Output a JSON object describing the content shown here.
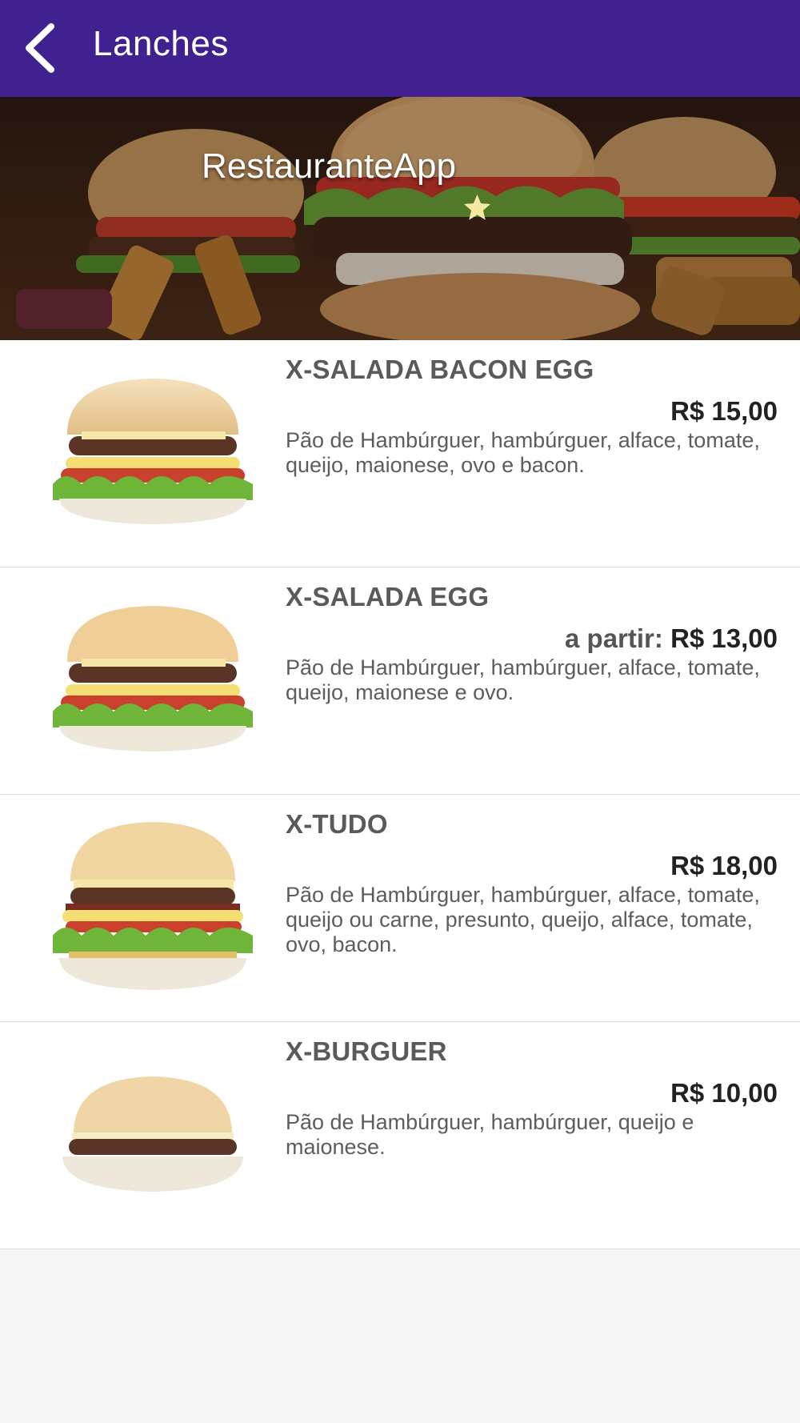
{
  "appbar": {
    "back_icon": "chevron-left-icon",
    "title": "Lanches",
    "background": "#40218f"
  },
  "hero": {
    "title": "RestauranteApp",
    "rating": 5,
    "star_color": "#f6e7a3"
  },
  "items": [
    {
      "name": "X-SALADA BACON EGG",
      "price_prefix": "",
      "price": "R$ 15,00",
      "description": "Pão de Hambúrguer, hambúrguer, alface, tomate, queijo, maionese, ovo e bacon."
    },
    {
      "name": "X-SALADA EGG",
      "price_prefix": "a partir: ",
      "price": "R$ 13,00",
      "description": "Pão de Hambúrguer, hambúrguer, alface, tomate, queijo, maionese e ovo."
    },
    {
      "name": "X-TUDO",
      "price_prefix": "",
      "price": "R$ 18,00",
      "description": "Pão de Hambúrguer, hambúrguer, alface, tomate, queijo ou carne, presunto, queijo, alface, tomate, ovo, bacon."
    },
    {
      "name": "X-BURGUER",
      "price_prefix": "",
      "price": "R$ 10,00",
      "description": "Pão de Hambúrguer, hambúrguer, queijo e maionese."
    }
  ]
}
